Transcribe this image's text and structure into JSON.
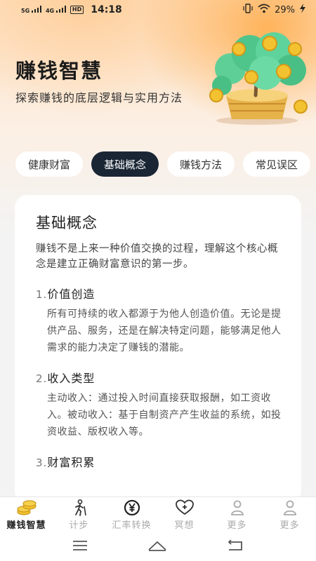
{
  "status_bar": {
    "signal1": "5G",
    "signal2": "4G",
    "hd": "HD",
    "time": "14:18",
    "battery": "29%"
  },
  "header": {
    "title": "赚钱智慧",
    "subtitle": "探索赚钱的底层逻辑与实用方法"
  },
  "tabs": [
    {
      "label": "健康财富",
      "active": false
    },
    {
      "label": "基础概念",
      "active": true
    },
    {
      "label": "赚钱方法",
      "active": false
    },
    {
      "label": "常见误区",
      "active": false
    }
  ],
  "card": {
    "title": "基础概念",
    "intro": "赚钱不是上来一种价值交换的过程，理解这个核心概念是建立正确财富意识的第一步。",
    "sections": [
      {
        "num": "1.",
        "title": "价值创造",
        "body": "所有可持续的收入都源于为他人创造价值。无论是提供产品、服务，还是在解决特定问题，能够满足他人需求的能力决定了赚钱的潜能。"
      },
      {
        "num": "2.",
        "title": "收入类型",
        "body": "主动收入：通过投入时间直接获取报酬，如工资收入。被动收入：基于自制资产产生收益的系统，如投资收益、版权收入等。"
      },
      {
        "num": "3.",
        "title": "财富积累",
        "body": ""
      }
    ]
  },
  "bottom_nav": [
    {
      "label": "赚钱智慧",
      "icon": "coins-icon",
      "active": true
    },
    {
      "label": "计步",
      "icon": "hiker-icon",
      "active": false
    },
    {
      "label": "汇率转换",
      "icon": "yen-icon",
      "active": false
    },
    {
      "label": "冥想",
      "icon": "heart-plus-icon",
      "active": false
    },
    {
      "label": "更多",
      "icon": "person-icon",
      "active": false
    },
    {
      "label": "更多",
      "icon": "person-icon",
      "active": false
    }
  ],
  "colors": {
    "accent_dark": "#1a2634",
    "hero_orange": "#ffaa46",
    "coin_gold": "#f2c230"
  }
}
